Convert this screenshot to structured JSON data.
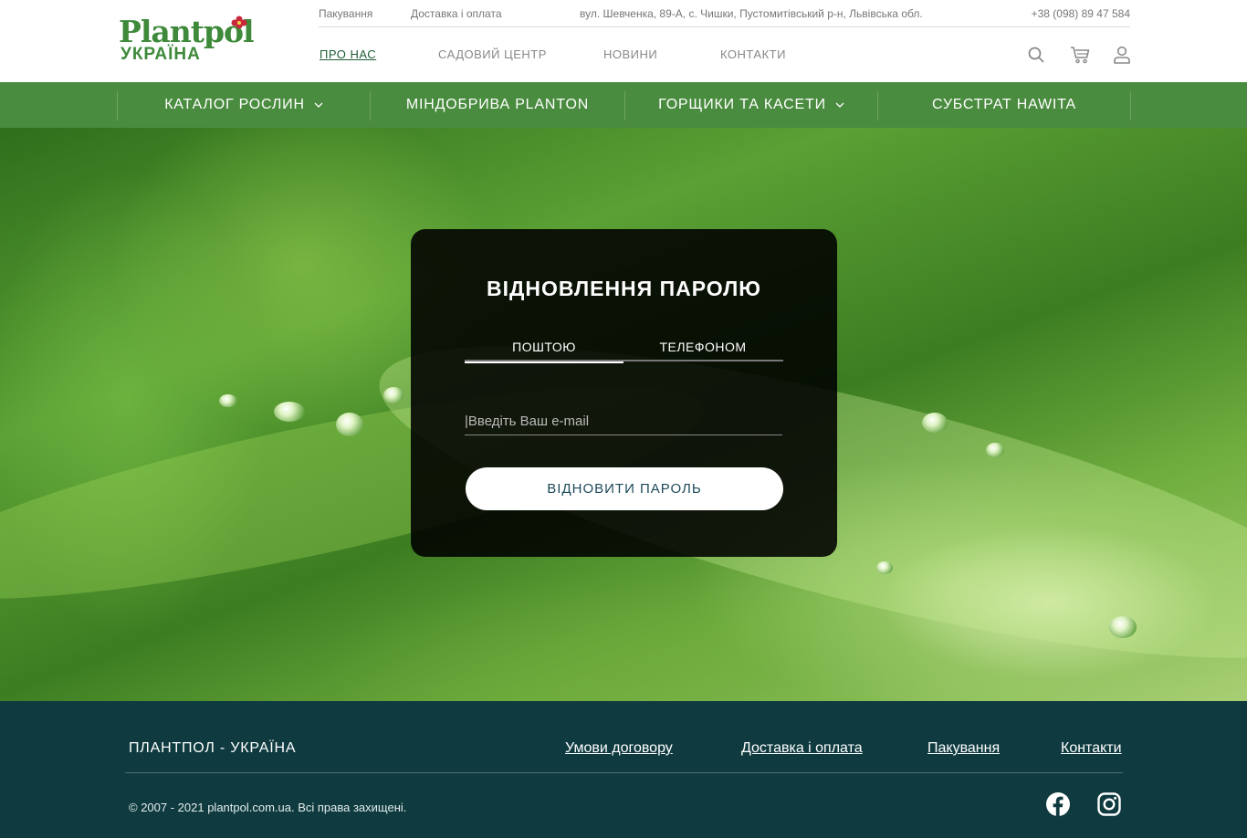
{
  "header": {
    "logo": {
      "top": "Plantpol",
      "bottom": "УКРАЇНА"
    },
    "top_links": {
      "packaging": "Пакування",
      "delivery": "Доставка і оплата",
      "address": "вул. Шевченка, 89-А, с. Чишки, Пустомитівський р-н, Львівська обл.",
      "phone": "+38 (098) 89 47 584"
    },
    "nav": {
      "about": "ПРО НАС",
      "garden": "САДОВИЙ ЦЕНТР",
      "news": "НОВИНИ",
      "contacts": "КОНТАКТИ"
    },
    "icons": [
      "search-icon",
      "cart-icon",
      "user-icon"
    ]
  },
  "categories": {
    "catalog": "КАТАЛОГ РОСЛИН",
    "fertilizers": "МІНДОБРИВА PLANTON",
    "pots": "ГОРЩИКИ ТА КАСЕТИ",
    "substrate": "СУБСТРАТ HAWITA"
  },
  "reset": {
    "title": "ВІДНОВЛЕННЯ ПАРОЛЮ",
    "tab_email": "ПОШТОЮ",
    "tab_phone": "ТЕЛЕФОНОМ",
    "active_tab": "ПОШТОЮ",
    "email_placeholder": "|Введіть Ваш e-mail",
    "email_value": "",
    "submit": "ВІДНОВИТИ ПАРОЛЬ"
  },
  "footer": {
    "brand": "ПЛАНТПОЛ - УКРАЇНА",
    "links": {
      "terms": "Умови договору",
      "delivery": "Доставка і оплата",
      "packaging": "Пакування",
      "contacts": "Контакти"
    },
    "copyright": "© 2007 - 2021 plantpol.com.ua. Всі права захищені.",
    "social": [
      "facebook-icon",
      "instagram-icon"
    ]
  },
  "colors": {
    "brand_green": "#4a8c3f",
    "logo_green": "#3e8a3a",
    "footer_bg": "#0f3b40",
    "button_text": "#1e4a5a"
  }
}
